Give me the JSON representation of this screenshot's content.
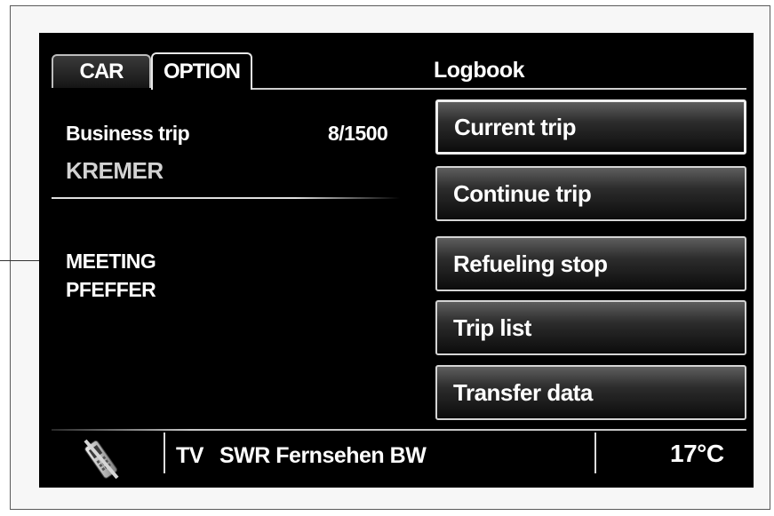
{
  "tabs": [
    {
      "label": "CAR",
      "active": false
    },
    {
      "label": "OPTION",
      "active": true
    }
  ],
  "header": {
    "title": "Logbook"
  },
  "trip": {
    "type_label": "Business trip",
    "count": "8/1500",
    "driver": "KREMER",
    "purpose_line1": "MEETING",
    "purpose_line2": "PFEFFER"
  },
  "menu": {
    "items": [
      {
        "label": "Current trip",
        "selected": true
      },
      {
        "label": "Continue trip",
        "selected": false
      },
      {
        "label": "Refueling stop",
        "selected": false
      },
      {
        "label": "Trip list",
        "selected": false
      },
      {
        "label": "Transfer data",
        "selected": false
      }
    ]
  },
  "status": {
    "phone_icon": "phone-crossed-icon",
    "source": "TV",
    "station": "SWR Fernsehen BW",
    "temperature": "17°C"
  }
}
